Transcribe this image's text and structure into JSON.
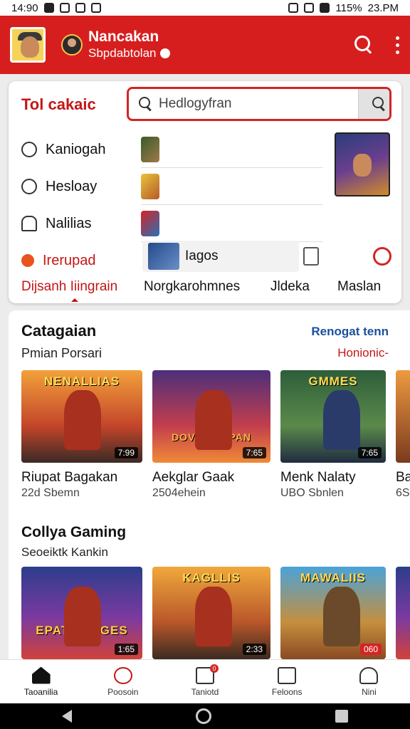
{
  "status_bar": {
    "time": "14:90",
    "battery": "115%",
    "clock_right": "23.PM"
  },
  "app_bar": {
    "title": "Nancakan",
    "subtitle": "Sbpdabtolan"
  },
  "top_card": {
    "title": "Tol cakaic",
    "search_placeholder": "Hedlogyfran",
    "menu": [
      {
        "label": "Kaniogah",
        "icon": "search-circle-icon"
      },
      {
        "label": "Hesloay",
        "icon": "refresh-icon"
      },
      {
        "label": "Nalilias",
        "icon": "clipboard-icon"
      },
      {
        "label": "Irerupad",
        "icon": "heart-icon",
        "active": true
      }
    ],
    "tool_chip_label": "Iagos",
    "tabs": [
      "Dijsanh Iiingrain",
      "Norgkarohmnes",
      "Jldeka",
      "Maslan"
    ]
  },
  "section_one": {
    "title": "Catagaian",
    "subtitle": "Pmian Porsari",
    "link": "Renogat tenn",
    "link2": "Honionic-",
    "games": [
      {
        "cover_text": "NENALLIAS",
        "duration": "7:99",
        "title": "Riupat Bagakan",
        "meta": "22d Sbemn"
      },
      {
        "cover_text": "DOVE SEAPAN",
        "duration": "7:65",
        "title": "Aekglar Gaak",
        "meta": "2504ehein"
      },
      {
        "cover_text": "GMMES",
        "duration": "7:65",
        "title": "Menk Nalaty",
        "meta": "UBO Sbnlen"
      },
      {
        "cover_text": "",
        "duration": "",
        "title": "Ba",
        "meta": "6S"
      }
    ]
  },
  "section_two": {
    "title": "Collya Gaming",
    "subtitle": "Seoeiktk Kankin",
    "games": [
      {
        "cover_text": "EPATS PUGES",
        "duration": "1:65"
      },
      {
        "cover_text": "KAGLLIS",
        "duration": "2:33"
      },
      {
        "cover_text": "MAWALIIS",
        "duration": "060"
      },
      {
        "cover_text": "",
        "duration": ""
      }
    ]
  },
  "bottom_nav": [
    {
      "label": "Taoanilia",
      "icon": "home-icon",
      "active": true
    },
    {
      "label": "Poosoin",
      "icon": "search-icon"
    },
    {
      "label": "Taniotd",
      "icon": "notes-icon",
      "badge": "0"
    },
    {
      "label": "Feloons",
      "icon": "lock-icon"
    },
    {
      "label": "Nini",
      "icon": "user-icon"
    }
  ],
  "colors": {
    "brand_red": "#d71e1e",
    "link_blue": "#1a4f9c"
  }
}
